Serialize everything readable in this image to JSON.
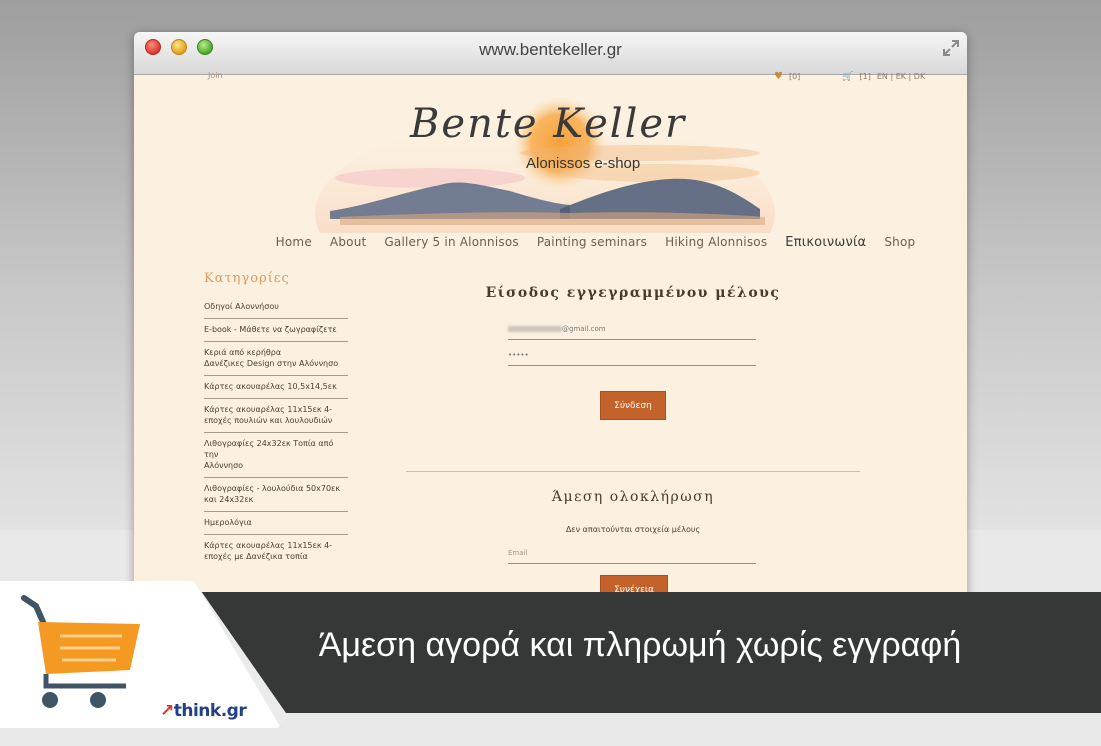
{
  "browser": {
    "url": "www.bentekeller.gr"
  },
  "topbar": {
    "left_text": "Join",
    "wishlist_count": "[0]",
    "cart_count": "[1]",
    "languages": "EN | EK | DK"
  },
  "logo": {
    "script": "Bente Keller",
    "subtitle": "Alonissos e-shop"
  },
  "nav": [
    "Home",
    "About",
    "Gallery 5 in Alonnisos",
    "Painting seminars",
    "Hiking Alonnisos",
    "Επικοινωνία",
    "Shop"
  ],
  "sidebar": {
    "title": "Κατηγορίες",
    "items": [
      "Οδηγοί Αλοννήσου",
      "E-book - Μάθετε να ζωγραφίζετε",
      "Κεριά από κερήθρα\nΔανέζικες Design στην Αλόννησο",
      "Κάρτες ακουαρέλας 10,5x14,5εκ",
      "Κάρτες ακουαρέλας 11x15εκ 4-\nεποχές πουλιών και λουλουδιών",
      "Λιθογραφίες 24x32εκ Τοπία από την\nΑλόννησο",
      "Λιθογραφίες - λουλούδια 50x70εκ\nκαι 24x32εκ",
      "Ημερολόγια",
      "Κάρτες ακουαρέλας 11x15εκ 4-\nεποχές με Δανέζικα τοπία"
    ]
  },
  "login": {
    "title": "Είσοδος εγγεγραμμένου μέλους",
    "email_value": "@gmail.com",
    "password_value": "•••••",
    "button": "Σύνδεση"
  },
  "quick": {
    "title": "Άμεση ολοκλήρωση",
    "subtitle": "Δεν απαιτούνται στοιχεία μέλους",
    "email_placeholder": "Email",
    "button": "Συνέχεια"
  },
  "banner": {
    "text": "Άμεση αγορά και πληρωμή χωρίς εγγραφή",
    "brand": "think.gr"
  },
  "colors": {
    "accent": "#c3622a",
    "page_bg": "#fcf1e1",
    "banner_bg": "#363838"
  }
}
